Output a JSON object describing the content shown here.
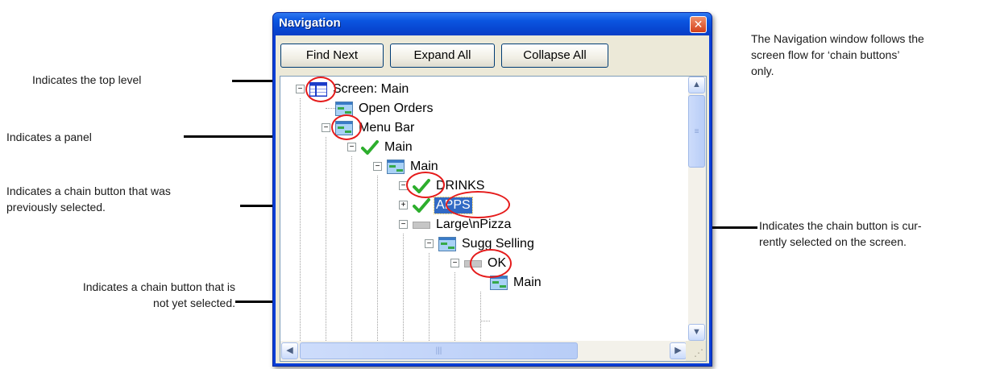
{
  "window": {
    "title": "Navigation",
    "buttons": {
      "find_next": "Find Next",
      "expand_all": "Expand All",
      "collapse_all": "Collapse All"
    }
  },
  "tree": {
    "nodes": [
      {
        "label": "Screen: Main",
        "icon": "screen-icon",
        "expander": "minus"
      },
      {
        "label": "Open Orders",
        "icon": "panel-icon",
        "expander": "none"
      },
      {
        "label": "Menu Bar",
        "icon": "panel-icon",
        "expander": "minus"
      },
      {
        "label": "Main",
        "icon": "check-icon",
        "expander": "minus"
      },
      {
        "label": "Main",
        "icon": "panel-icon",
        "expander": "minus"
      },
      {
        "label": "DRINKS",
        "icon": "check-icon",
        "expander": "minus"
      },
      {
        "label": "APPS",
        "icon": "check-icon",
        "expander": "plus",
        "selected": true
      },
      {
        "label": "Large\\nPizza",
        "icon": "gray-button-icon",
        "expander": "minus"
      },
      {
        "label": "Sugg Selling",
        "icon": "panel-icon",
        "expander": "minus"
      },
      {
        "label": "OK",
        "icon": "gray-button-icon",
        "expander": "minus"
      },
      {
        "label": "Main",
        "icon": "panel-icon",
        "expander": "none"
      }
    ]
  },
  "callouts": {
    "top_level": "Indicates the top level",
    "panel": "Indicates a panel",
    "previously_selected_line1": "Indicates a chain button that was",
    "previously_selected_line2": "previously selected.",
    "not_yet_selected_line1": "Indicates a chain button that is",
    "not_yet_selected_line2": "not yet selected.",
    "currently_selected_line1": "Indicates the chain button is cur-",
    "currently_selected_line2": "rently selected on the screen.",
    "note_line1": "The Navigation window follows the",
    "note_line2": "screen flow for ‘chain buttons’",
    "note_line3": "only."
  },
  "colors": {
    "title_bar": "#0b55e0",
    "selection": "#316ac5",
    "annotation_ring": "#e51b1b",
    "check": "#2dae2d"
  }
}
